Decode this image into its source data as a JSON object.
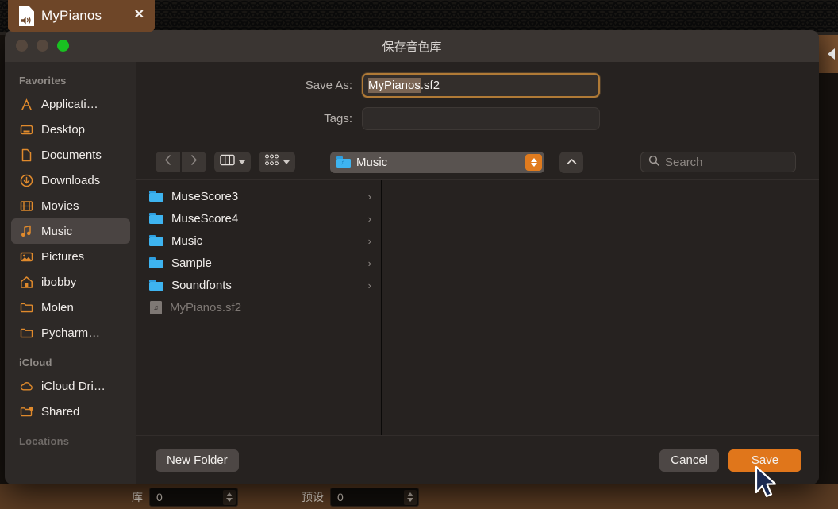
{
  "app": {
    "tab": {
      "title": "MyPianos",
      "icon": "soundfont-document-icon",
      "close_label": "✕"
    },
    "right_panel": {
      "icon": "collapse-left-triangle-icon"
    },
    "bottom": {
      "bank_label": "库",
      "bank_value": "0",
      "preset_label": "预设",
      "preset_value": "0"
    }
  },
  "sheet": {
    "title": "保存音色库",
    "window_controls": [
      "close",
      "minimize",
      "zoom"
    ],
    "form": {
      "save_as_label": "Save As:",
      "save_as_selected": "MyPianos",
      "save_as_rest": ".sf2",
      "tags_label": "Tags:",
      "tags_value": ""
    },
    "toolbar": {
      "back_icon": "chevron-left-icon",
      "forward_icon": "chevron-right-icon",
      "view_icon": "column-view-icon",
      "group_icon": "group-by-icon",
      "location_name": "Music",
      "location_icon": "music-folder-icon",
      "up_icon": "chevron-up-icon",
      "search_placeholder": "Search",
      "search_icon": "search-icon",
      "search_value": ""
    },
    "files": [
      {
        "name": "MuseScore3",
        "kind": "folder",
        "disclosure": "›"
      },
      {
        "name": "MuseScore4",
        "kind": "folder",
        "disclosure": "›"
      },
      {
        "name": "Music",
        "kind": "folder",
        "disclosure": "›"
      },
      {
        "name": "Sample",
        "kind": "folder",
        "disclosure": "›"
      },
      {
        "name": "Soundfonts",
        "kind": "folder",
        "disclosure": "›"
      },
      {
        "name": "MyPianos.sf2",
        "kind": "file",
        "disclosure": ""
      }
    ],
    "sidebar": {
      "sections": [
        {
          "header": "Favorites",
          "items": [
            {
              "label": "Applicati…",
              "icon": "applications-icon",
              "selected": false
            },
            {
              "label": "Desktop",
              "icon": "desktop-icon",
              "selected": false
            },
            {
              "label": "Documents",
              "icon": "documents-icon",
              "selected": false
            },
            {
              "label": "Downloads",
              "icon": "downloads-icon",
              "selected": false
            },
            {
              "label": "Movies",
              "icon": "movies-icon",
              "selected": false
            },
            {
              "label": "Music",
              "icon": "music-note-icon",
              "selected": true
            },
            {
              "label": "Pictures",
              "icon": "pictures-icon",
              "selected": false
            },
            {
              "label": "ibobby",
              "icon": "home-icon",
              "selected": false
            },
            {
              "label": "Molen",
              "icon": "folder-icon",
              "selected": false
            },
            {
              "label": "Pycharm…",
              "icon": "folder-icon",
              "selected": false
            }
          ]
        },
        {
          "header": "iCloud",
          "items": [
            {
              "label": "iCloud Dri…",
              "icon": "icloud-icon",
              "selected": false
            },
            {
              "label": "Shared",
              "icon": "shared-folder-icon",
              "selected": false
            }
          ]
        },
        {
          "header": "Locations",
          "items": []
        }
      ]
    },
    "footer": {
      "new_folder_label": "New Folder",
      "cancel_label": "Cancel",
      "save_label": "Save"
    }
  },
  "colors": {
    "accent_orange": "#e0761b",
    "focus_ring": "#b07a36",
    "tab_brown": "#6e4628",
    "folder_blue": "#3eb4f0",
    "sidebar_icon": "#e08a2c",
    "green_button": "#19c021"
  }
}
